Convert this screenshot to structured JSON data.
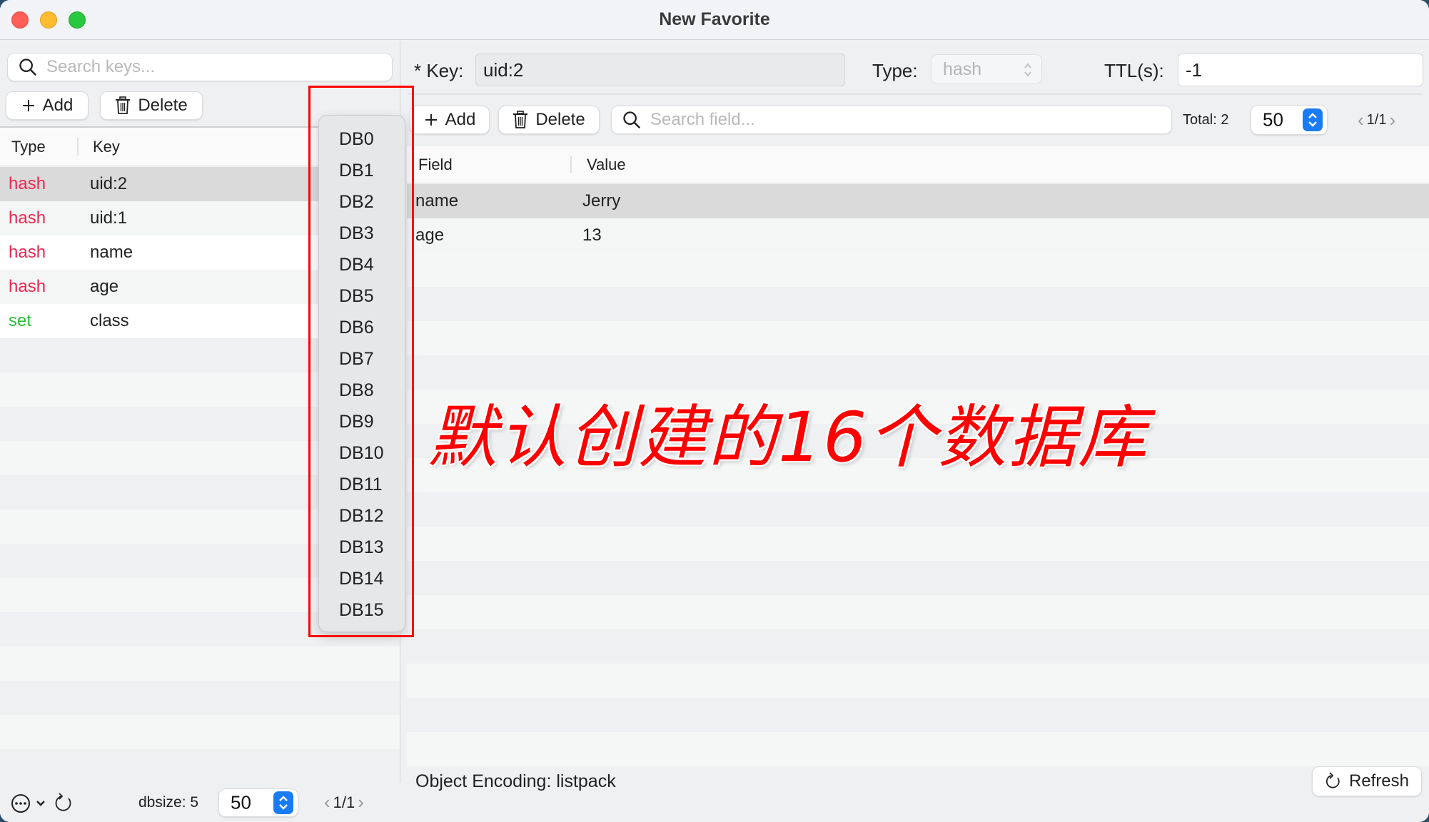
{
  "window": {
    "title": "New Favorite"
  },
  "left": {
    "search_placeholder": "Search keys...",
    "add_label": "Add",
    "delete_label": "Delete",
    "db_selected": "DB0",
    "columns": [
      "Type",
      "Key"
    ],
    "rows": [
      {
        "type": "hash",
        "key": "uid:2",
        "selected": true
      },
      {
        "type": "hash",
        "key": "uid:1",
        "selected": false
      },
      {
        "type": "hash",
        "key": "name",
        "selected": false
      },
      {
        "type": "hash",
        "key": "age",
        "selected": false
      },
      {
        "type": "set",
        "key": "class",
        "selected": false
      }
    ],
    "footer": {
      "dbsize_label": "dbsize: 5",
      "page_size": "50",
      "pager": "1/1"
    }
  },
  "db_dropdown": {
    "options": [
      "DB0",
      "DB1",
      "DB2",
      "DB3",
      "DB4",
      "DB5",
      "DB6",
      "DB7",
      "DB8",
      "DB9",
      "DB10",
      "DB11",
      "DB12",
      "DB13",
      "DB14",
      "DB15"
    ]
  },
  "right": {
    "key_label": "* Key:",
    "key_value": "uid:2",
    "type_label": "Type:",
    "type_value": "hash",
    "ttl_label": "TTL(s):",
    "ttl_value": "-1",
    "add_label": "Add",
    "delete_label": "Delete",
    "search_placeholder": "Search field...",
    "total_label": "Total: 2",
    "page_size": "50",
    "pager": "1/1",
    "columns": [
      "Field",
      "Value"
    ],
    "rows": [
      {
        "field": "name",
        "value": "Jerry",
        "selected": true
      },
      {
        "field": "age",
        "value": "13",
        "selected": false
      }
    ],
    "encoding_label": "Object Encoding: listpack",
    "refresh_label": "Refresh"
  },
  "annotation": {
    "text": "默认创建的16个数据库",
    "color": "#ff0000"
  },
  "colors": {
    "hash": "#f0264f",
    "set": "#2bbd3c",
    "accent": "#1a7cf5"
  }
}
